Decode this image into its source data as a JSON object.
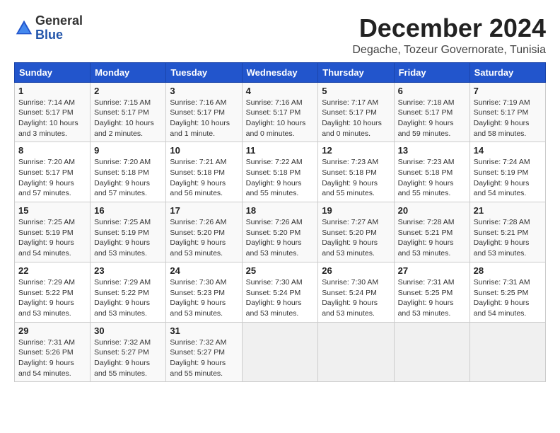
{
  "header": {
    "logo_general": "General",
    "logo_blue": "Blue",
    "title": "December 2024",
    "subtitle": "Degache, Tozeur Governorate, Tunisia"
  },
  "columns": [
    "Sunday",
    "Monday",
    "Tuesday",
    "Wednesday",
    "Thursday",
    "Friday",
    "Saturday"
  ],
  "weeks": [
    [
      {
        "day": "1",
        "sunrise": "Sunrise: 7:14 AM",
        "sunset": "Sunset: 5:17 PM",
        "daylight": "Daylight: 10 hours and 3 minutes."
      },
      {
        "day": "2",
        "sunrise": "Sunrise: 7:15 AM",
        "sunset": "Sunset: 5:17 PM",
        "daylight": "Daylight: 10 hours and 2 minutes."
      },
      {
        "day": "3",
        "sunrise": "Sunrise: 7:16 AM",
        "sunset": "Sunset: 5:17 PM",
        "daylight": "Daylight: 10 hours and 1 minute."
      },
      {
        "day": "4",
        "sunrise": "Sunrise: 7:16 AM",
        "sunset": "Sunset: 5:17 PM",
        "daylight": "Daylight: 10 hours and 0 minutes."
      },
      {
        "day": "5",
        "sunrise": "Sunrise: 7:17 AM",
        "sunset": "Sunset: 5:17 PM",
        "daylight": "Daylight: 10 hours and 0 minutes."
      },
      {
        "day": "6",
        "sunrise": "Sunrise: 7:18 AM",
        "sunset": "Sunset: 5:17 PM",
        "daylight": "Daylight: 9 hours and 59 minutes."
      },
      {
        "day": "7",
        "sunrise": "Sunrise: 7:19 AM",
        "sunset": "Sunset: 5:17 PM",
        "daylight": "Daylight: 9 hours and 58 minutes."
      }
    ],
    [
      {
        "day": "8",
        "sunrise": "Sunrise: 7:20 AM",
        "sunset": "Sunset: 5:17 PM",
        "daylight": "Daylight: 9 hours and 57 minutes."
      },
      {
        "day": "9",
        "sunrise": "Sunrise: 7:20 AM",
        "sunset": "Sunset: 5:18 PM",
        "daylight": "Daylight: 9 hours and 57 minutes."
      },
      {
        "day": "10",
        "sunrise": "Sunrise: 7:21 AM",
        "sunset": "Sunset: 5:18 PM",
        "daylight": "Daylight: 9 hours and 56 minutes."
      },
      {
        "day": "11",
        "sunrise": "Sunrise: 7:22 AM",
        "sunset": "Sunset: 5:18 PM",
        "daylight": "Daylight: 9 hours and 55 minutes."
      },
      {
        "day": "12",
        "sunrise": "Sunrise: 7:23 AM",
        "sunset": "Sunset: 5:18 PM",
        "daylight": "Daylight: 9 hours and 55 minutes."
      },
      {
        "day": "13",
        "sunrise": "Sunrise: 7:23 AM",
        "sunset": "Sunset: 5:18 PM",
        "daylight": "Daylight: 9 hours and 55 minutes."
      },
      {
        "day": "14",
        "sunrise": "Sunrise: 7:24 AM",
        "sunset": "Sunset: 5:19 PM",
        "daylight": "Daylight: 9 hours and 54 minutes."
      }
    ],
    [
      {
        "day": "15",
        "sunrise": "Sunrise: 7:25 AM",
        "sunset": "Sunset: 5:19 PM",
        "daylight": "Daylight: 9 hours and 54 minutes."
      },
      {
        "day": "16",
        "sunrise": "Sunrise: 7:25 AM",
        "sunset": "Sunset: 5:19 PM",
        "daylight": "Daylight: 9 hours and 53 minutes."
      },
      {
        "day": "17",
        "sunrise": "Sunrise: 7:26 AM",
        "sunset": "Sunset: 5:20 PM",
        "daylight": "Daylight: 9 hours and 53 minutes."
      },
      {
        "day": "18",
        "sunrise": "Sunrise: 7:26 AM",
        "sunset": "Sunset: 5:20 PM",
        "daylight": "Daylight: 9 hours and 53 minutes."
      },
      {
        "day": "19",
        "sunrise": "Sunrise: 7:27 AM",
        "sunset": "Sunset: 5:20 PM",
        "daylight": "Daylight: 9 hours and 53 minutes."
      },
      {
        "day": "20",
        "sunrise": "Sunrise: 7:28 AM",
        "sunset": "Sunset: 5:21 PM",
        "daylight": "Daylight: 9 hours and 53 minutes."
      },
      {
        "day": "21",
        "sunrise": "Sunrise: 7:28 AM",
        "sunset": "Sunset: 5:21 PM",
        "daylight": "Daylight: 9 hours and 53 minutes."
      }
    ],
    [
      {
        "day": "22",
        "sunrise": "Sunrise: 7:29 AM",
        "sunset": "Sunset: 5:22 PM",
        "daylight": "Daylight: 9 hours and 53 minutes."
      },
      {
        "day": "23",
        "sunrise": "Sunrise: 7:29 AM",
        "sunset": "Sunset: 5:22 PM",
        "daylight": "Daylight: 9 hours and 53 minutes."
      },
      {
        "day": "24",
        "sunrise": "Sunrise: 7:30 AM",
        "sunset": "Sunset: 5:23 PM",
        "daylight": "Daylight: 9 hours and 53 minutes."
      },
      {
        "day": "25",
        "sunrise": "Sunrise: 7:30 AM",
        "sunset": "Sunset: 5:24 PM",
        "daylight": "Daylight: 9 hours and 53 minutes."
      },
      {
        "day": "26",
        "sunrise": "Sunrise: 7:30 AM",
        "sunset": "Sunset: 5:24 PM",
        "daylight": "Daylight: 9 hours and 53 minutes."
      },
      {
        "day": "27",
        "sunrise": "Sunrise: 7:31 AM",
        "sunset": "Sunset: 5:25 PM",
        "daylight": "Daylight: 9 hours and 53 minutes."
      },
      {
        "day": "28",
        "sunrise": "Sunrise: 7:31 AM",
        "sunset": "Sunset: 5:25 PM",
        "daylight": "Daylight: 9 hours and 54 minutes."
      }
    ],
    [
      {
        "day": "29",
        "sunrise": "Sunrise: 7:31 AM",
        "sunset": "Sunset: 5:26 PM",
        "daylight": "Daylight: 9 hours and 54 minutes."
      },
      {
        "day": "30",
        "sunrise": "Sunrise: 7:32 AM",
        "sunset": "Sunset: 5:27 PM",
        "daylight": "Daylight: 9 hours and 55 minutes."
      },
      {
        "day": "31",
        "sunrise": "Sunrise: 7:32 AM",
        "sunset": "Sunset: 5:27 PM",
        "daylight": "Daylight: 9 hours and 55 minutes."
      },
      null,
      null,
      null,
      null
    ]
  ]
}
